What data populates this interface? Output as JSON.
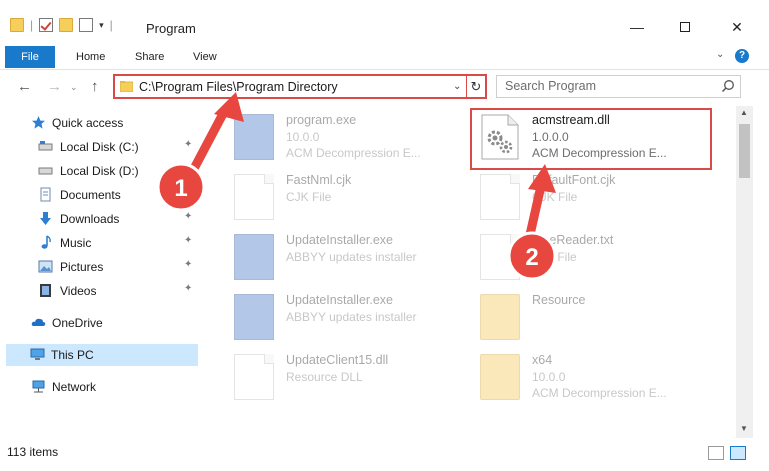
{
  "window": {
    "title": "Program",
    "minimize_glyph": "—",
    "close_glyph": "✕"
  },
  "ribbon": {
    "tabs": [
      "File",
      "Home",
      "Share",
      "View"
    ],
    "help_glyph": "?",
    "collapse_glyph": "⌄"
  },
  "nav": {
    "back_glyph": "←",
    "forward_glyph": "→",
    "recent_glyph": "⌄",
    "up_glyph": "↑",
    "address_path": "C:\\Program Files\\Program Directory",
    "address_dropdown_glyph": "⌄",
    "refresh_glyph": "↻",
    "search_placeholder": "Search Program"
  },
  "sidebar": {
    "items": [
      {
        "label": "Quick access",
        "icon": "star-icon",
        "pinned": false
      },
      {
        "label": "Local Disk (C:)",
        "icon": "drive-icon",
        "pinned": true
      },
      {
        "label": "Local Disk (D:)",
        "icon": "drive-icon",
        "pinned": false
      },
      {
        "label": "Documents",
        "icon": "documents-icon",
        "pinned": true
      },
      {
        "label": "Downloads",
        "icon": "download-icon",
        "pinned": true
      },
      {
        "label": "Music",
        "icon": "music-icon",
        "pinned": true
      },
      {
        "label": "Pictures",
        "icon": "pictures-icon",
        "pinned": true
      },
      {
        "label": "Videos",
        "icon": "videos-icon",
        "pinned": true
      },
      {
        "label": "OneDrive",
        "icon": "cloud-icon",
        "pinned": false
      },
      {
        "label": "This PC",
        "icon": "computer-icon",
        "pinned": false,
        "selected": true
      },
      {
        "label": "Network",
        "icon": "network-icon",
        "pinned": false
      }
    ],
    "pin_glyph": "📌"
  },
  "files": [
    {
      "name": "program.exe",
      "line2": "10.0.0",
      "line3": "ACM Decompression E...",
      "icon": "application-icon",
      "faded": true
    },
    {
      "name": "acmstream.dll",
      "line2": "1.0.0.0",
      "line3": "ACM Decompression E...",
      "icon": "dll-gear-icon",
      "faded": false,
      "highlighted": true
    },
    {
      "name": "FastNml.cjk",
      "line2": "CJK File",
      "line3": "",
      "icon": "document-icon",
      "faded": true
    },
    {
      "name": "DefaultFont.cjk",
      "line2": "CJK File",
      "line3": "",
      "icon": "document-icon",
      "faded": true
    },
    {
      "name": "UpdateInstaller.exe",
      "line2": "ABBYY updates installer",
      "line3": "",
      "icon": "installer-icon",
      "faded": true
    },
    {
      "name": "FineReader.txt",
      "line2": "Text File",
      "line3": "",
      "icon": "document-icon",
      "faded": true
    },
    {
      "name": "UpdateInstaller.exe",
      "line2": "ABBYY updates installer",
      "line3": "",
      "icon": "installer-icon",
      "faded": true
    },
    {
      "name": "Resource",
      "line2": "",
      "line3": "",
      "icon": "folder-icon",
      "faded": true
    },
    {
      "name": "UpdateClient15.dll",
      "line2": "Resource DLL",
      "line3": "",
      "icon": "dll-gear-icon",
      "faded": true
    },
    {
      "name": "x64",
      "line2": "10.0.0",
      "line3": "ACM Decompression E...",
      "icon": "folder-icon",
      "faded": true
    }
  ],
  "status": {
    "item_count": "113 items"
  },
  "annotations": [
    {
      "label": "1",
      "color": "#e8473f"
    },
    {
      "label": "2",
      "color": "#e8473f"
    }
  ],
  "colors": {
    "accent": "#1979ca",
    "highlight_red": "#d94b44",
    "selection": "#cce8ff"
  }
}
